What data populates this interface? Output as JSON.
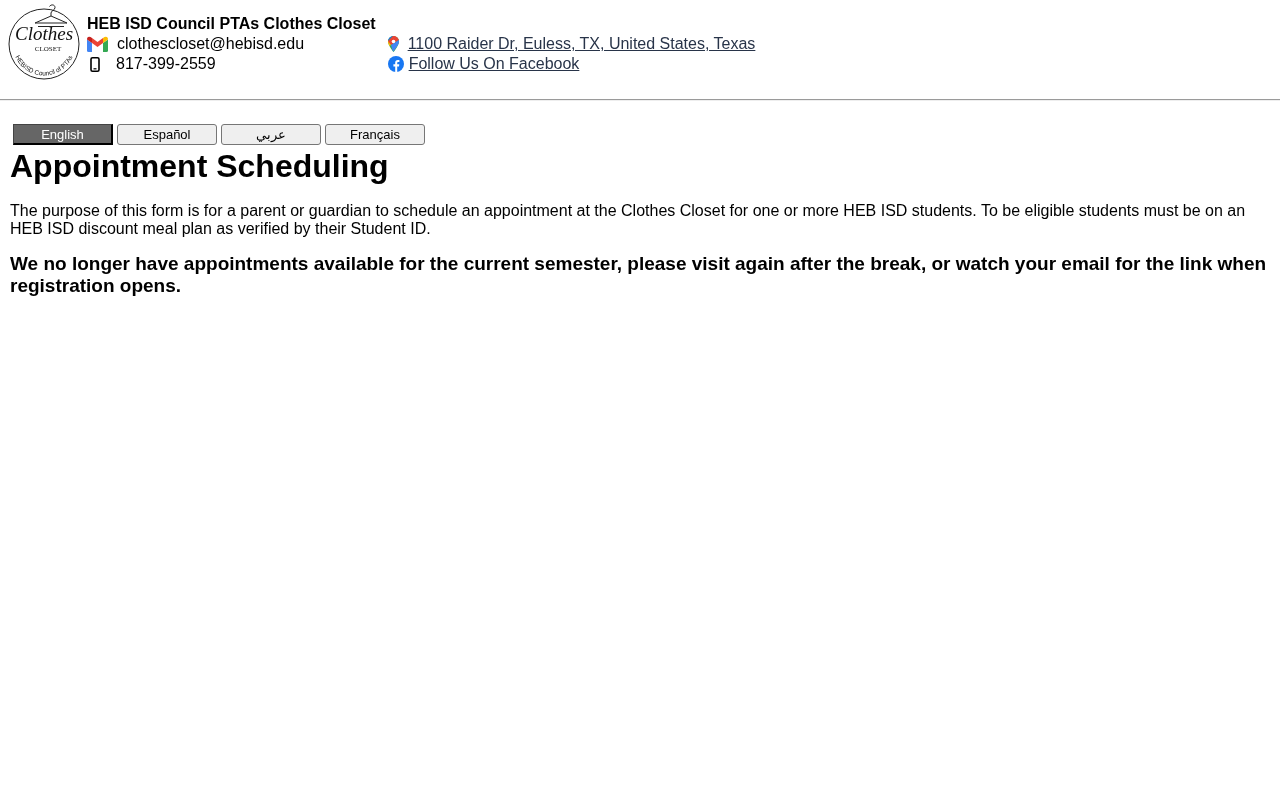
{
  "header": {
    "logo": {
      "script_text": "Clothes",
      "banner_text": "CLOSET",
      "ring_text": "HEBISD Council of PTAs"
    },
    "title": "HEB ISD Council PTAs Clothes Closet",
    "contacts": [
      {
        "kind": "email",
        "text": "clothescloset@hebisd.edu"
      },
      {
        "kind": "phone",
        "text": "817-399-2559"
      }
    ],
    "links": [
      {
        "kind": "map",
        "text": "1100 Raider Dr, Euless, TX, United States, Texas"
      },
      {
        "kind": "facebook",
        "text": "Follow Us On Facebook"
      }
    ]
  },
  "language_buttons": [
    {
      "label": "English",
      "selected": true
    },
    {
      "label": "Español",
      "selected": false
    },
    {
      "label": "عربي",
      "selected": false
    },
    {
      "label": "Français",
      "selected": false
    }
  ],
  "heading": "Appointment Scheduling",
  "intro": "The purpose of this form is for a parent or guardian to schedule an appointment at the Clothes Closet for one or more HEB ISD students. To be eligible students must be on an HEB ISD discount meal plan as verified by their Student ID.",
  "notice": "We no longer have appointments available for the current semester, please visit again after the break, or watch your email for the link when registration opens."
}
